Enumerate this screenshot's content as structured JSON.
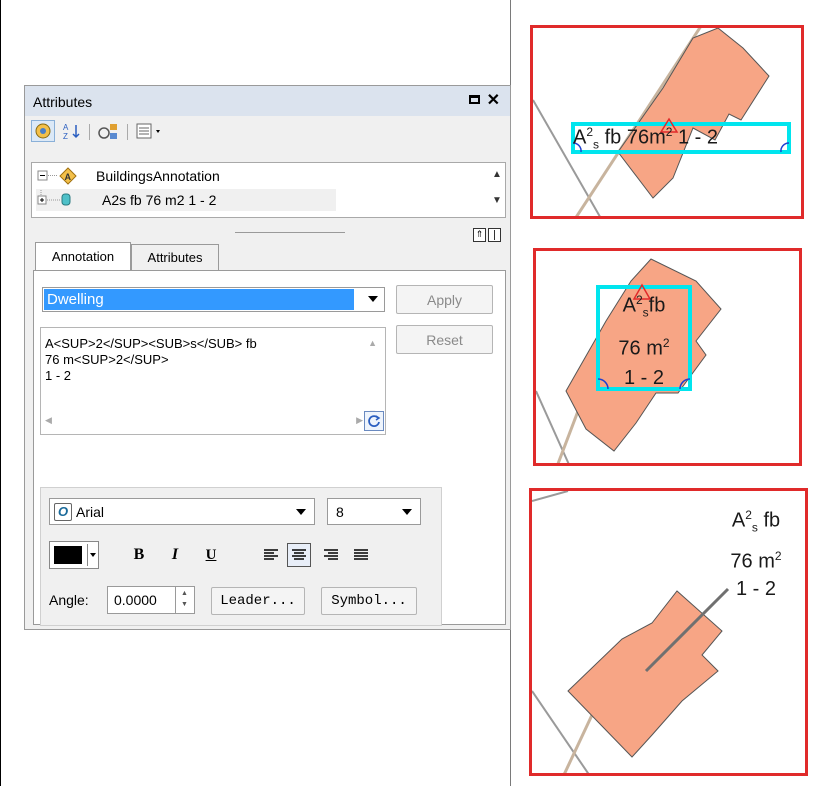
{
  "window": {
    "title": "Attributes"
  },
  "tree": {
    "root_label": "BuildingsAnnotation",
    "child_label": "A2s fb 76 m2 1 - 2"
  },
  "tabs": [
    {
      "label": "Annotation"
    },
    {
      "label": "Attributes"
    }
  ],
  "annotation": {
    "class_value": "Dwelling",
    "apply_label": "Apply",
    "reset_label": "Reset",
    "text_content": "A<SUP>2</SUP><SUB>s</SUB> fb\n76 m<SUP>2</SUP>\n1 - 2"
  },
  "font": {
    "name": "Arial",
    "size": "8",
    "bold_label": "B",
    "italic_label": "I",
    "underline_label": "U",
    "angle_label": "Angle:",
    "angle_value": "0.0000",
    "leader_label": "Leader...",
    "symbol_label": "Symbol..."
  },
  "maps": {
    "map1_label_base": "A",
    "map1_label_sup": "2",
    "map1_label_sub": "s",
    "map1_label_rest": "fb 76",
    "map1_label_m": "m",
    "map1_label_m_sup": "2",
    "map1_label_end": "1 - 2",
    "map2_line1_base": "A",
    "map2_line1_sup": "2",
    "map2_line1_sub": "s",
    "map2_line1_rest": "fb",
    "map2_line2": "76",
    "map2_line2_m": "m",
    "map2_line2_sup": "2",
    "map2_line3": "1 - 2",
    "map3_line1_base": "A",
    "map3_line1_sup": "2",
    "map3_line1_sub": "s",
    "map3_line1_rest": "fb",
    "map3_line2": "76 m",
    "map3_line2_sup": "2",
    "map3_line3": "1 - 2"
  },
  "colors": {
    "building_fill": "#f7a585",
    "selection_outline": "#00e5ee",
    "map_border": "#e02a2a",
    "selected_item": "#3399ff"
  }
}
